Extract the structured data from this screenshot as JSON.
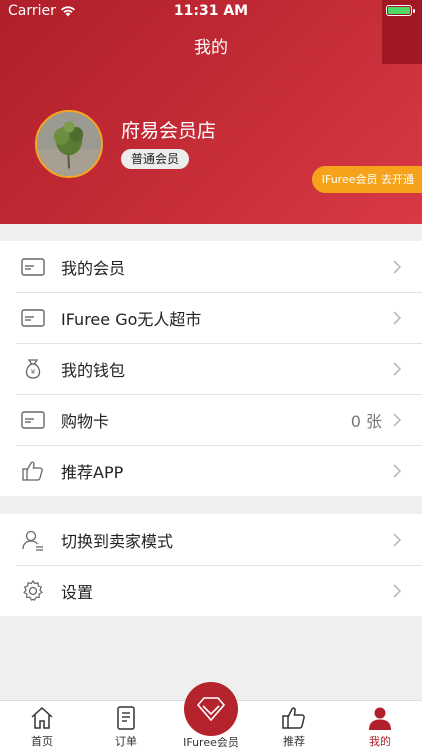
{
  "status_bar": {
    "carrier": "Carrier",
    "time": "11:31 AM"
  },
  "nav": {
    "title": "我的"
  },
  "profile": {
    "store_name": "府易会员店",
    "level": "普通会员",
    "vip_promo": "IFuree会员 去开通"
  },
  "menu_group1": [
    {
      "label": "我的会员",
      "value": "",
      "icon": "card-icon"
    },
    {
      "label": "IFuree Go无人超市",
      "value": "",
      "icon": "card-icon"
    },
    {
      "label": "我的钱包",
      "value": "",
      "icon": "money-bag-icon"
    },
    {
      "label": "购物卡",
      "value": "0 张",
      "icon": "card-icon"
    },
    {
      "label": "推荐APP",
      "value": "",
      "icon": "thumbs-up-icon"
    }
  ],
  "menu_group2": [
    {
      "label": "切换到卖家模式",
      "value": "",
      "icon": "user-switch-icon"
    },
    {
      "label": "设置",
      "value": "",
      "icon": "gear-icon"
    }
  ],
  "tabbar": {
    "home": "首页",
    "orders": "订单",
    "member": "IFuree会员",
    "recommend": "推荐",
    "mine": "我的"
  },
  "colors": {
    "brand": "#b01f2a",
    "promo": "#f7a21b"
  }
}
